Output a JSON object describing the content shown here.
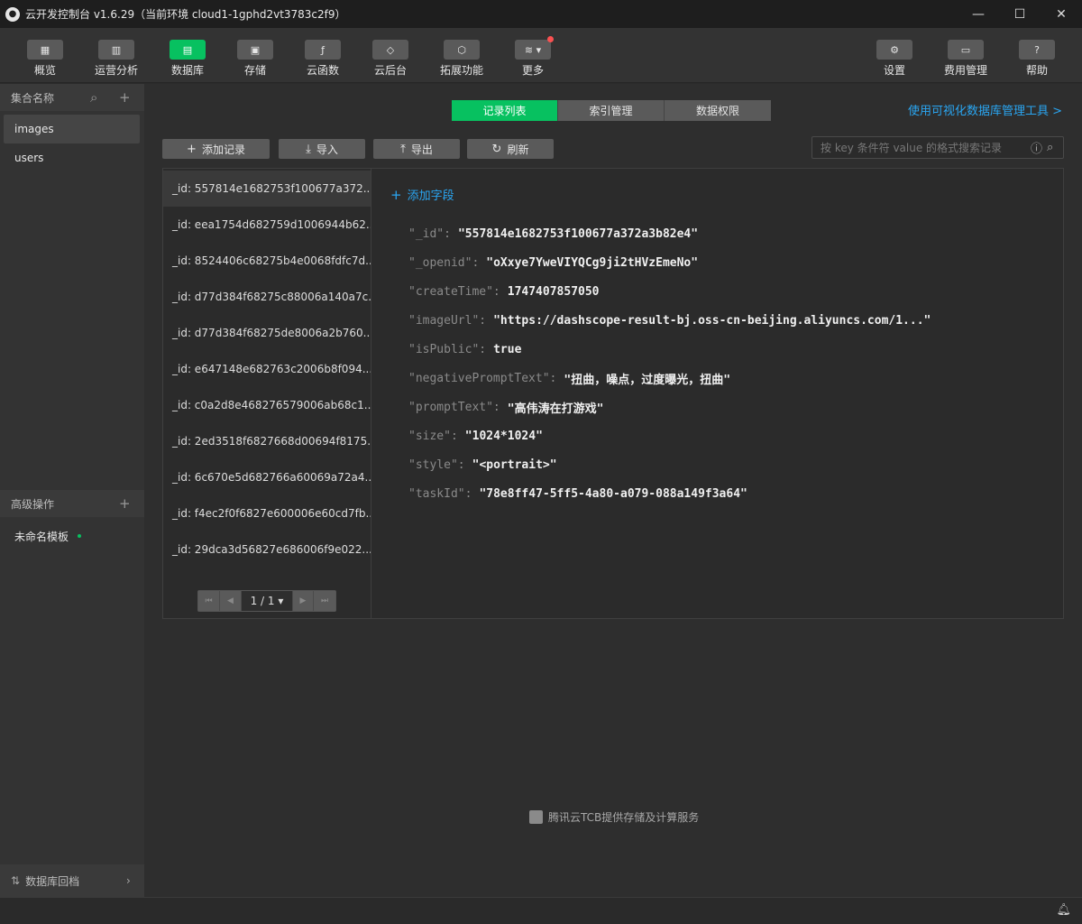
{
  "window": {
    "title": "云开发控制台 v1.6.29（当前环境 cloud1-1gphd2vt3783c2f9）",
    "minimize": "—",
    "maximize": "☐",
    "close": "✕"
  },
  "toolbar": {
    "items": [
      {
        "label": "概览",
        "icon": "grid-icon",
        "glyph": "▦"
      },
      {
        "label": "运营分析",
        "icon": "bar-chart-icon",
        "glyph": "▥"
      },
      {
        "label": "数据库",
        "icon": "database-icon",
        "glyph": "▤",
        "active": true
      },
      {
        "label": "存储",
        "icon": "storage-icon",
        "glyph": "▣"
      },
      {
        "label": "云函数",
        "icon": "function-icon",
        "glyph": "ƒ"
      },
      {
        "label": "云后台",
        "icon": "cube-icon",
        "glyph": "◇"
      },
      {
        "label": "拓展功能",
        "icon": "extension-icon",
        "glyph": "⬡"
      },
      {
        "label": "更多",
        "icon": "layers-icon",
        "glyph": "≋ ▾"
      },
      {
        "label": "设置",
        "icon": "gear-icon",
        "glyph": "⚙"
      },
      {
        "label": "费用管理",
        "icon": "billing-icon",
        "glyph": "▭"
      },
      {
        "label": "帮助",
        "icon": "help-icon",
        "glyph": "?"
      }
    ]
  },
  "sidebar": {
    "collections_header": "集合名称",
    "collections": [
      "images",
      "users"
    ],
    "advanced_header": "高级操作",
    "advanced_items": [
      "未命名模板"
    ],
    "footer": "数据库回档"
  },
  "main": {
    "tabs": [
      "记录列表",
      "索引管理",
      "数据权限"
    ],
    "active_tab": "记录列表",
    "visual_tool_link": "使用可视化数据库管理工具 >",
    "actions": {
      "add": "添加记录",
      "import": "导入",
      "export": "导出",
      "refresh": "刷新"
    },
    "search_placeholder": "按 key 条件符 value 的格式搜索记录",
    "records": [
      "_id: 557814e1682753f100677a372...",
      "_id: eea1754d682759d1006944b62...",
      "_id: 8524406c68275b4e0068fdfc7d...",
      "_id: d77d384f68275c88006a140a7c...",
      "_id: d77d384f68275de8006a2b760...",
      "_id: e647148e682763c2006b8f094...",
      "_id: c0a2d8e468276579006ab68c1...",
      "_id: 2ed3518f6827668d00694f8175...",
      "_id: 6c670e5d682766a60069a72a4...",
      "_id: f4ec2f0f6827e600006e60cd7fb...",
      "_id: 29dca3d56827e686006f9e022..."
    ],
    "pager": "1 / 1 ▾",
    "add_field": "添加字段",
    "fields": [
      {
        "key": "\"_id\"",
        "value": "\"557814e1682753f100677a372a3b82e4\""
      },
      {
        "key": "\"_openid\"",
        "value": "\"oXxye7YweVIYQCg9ji2tHVzEmeNo\""
      },
      {
        "key": "\"createTime\"",
        "value": "1747407857050"
      },
      {
        "key": "\"imageUrl\"",
        "value": "\"https://dashscope-result-bj.oss-cn-beijing.aliyuncs.com/1...\""
      },
      {
        "key": "\"isPublic\"",
        "value": "true"
      },
      {
        "key": "\"negativePromptText\"",
        "value": "\"扭曲，噪点，过度曝光，扭曲\""
      },
      {
        "key": "\"promptText\"",
        "value": "\"高伟涛在打游戏\""
      },
      {
        "key": "\"size\"",
        "value": "\"1024*1024\""
      },
      {
        "key": "\"style\"",
        "value": "\"<portrait>\""
      },
      {
        "key": "\"taskId\"",
        "value": "\"78e8ff47-5ff5-4a80-a079-088a149f3a64\""
      }
    ],
    "credit": "腾讯云TCB提供存储及计算服务"
  },
  "colors": {
    "accent": "#07c160",
    "link": "#2aa6f2",
    "badge": "#fa5151"
  }
}
